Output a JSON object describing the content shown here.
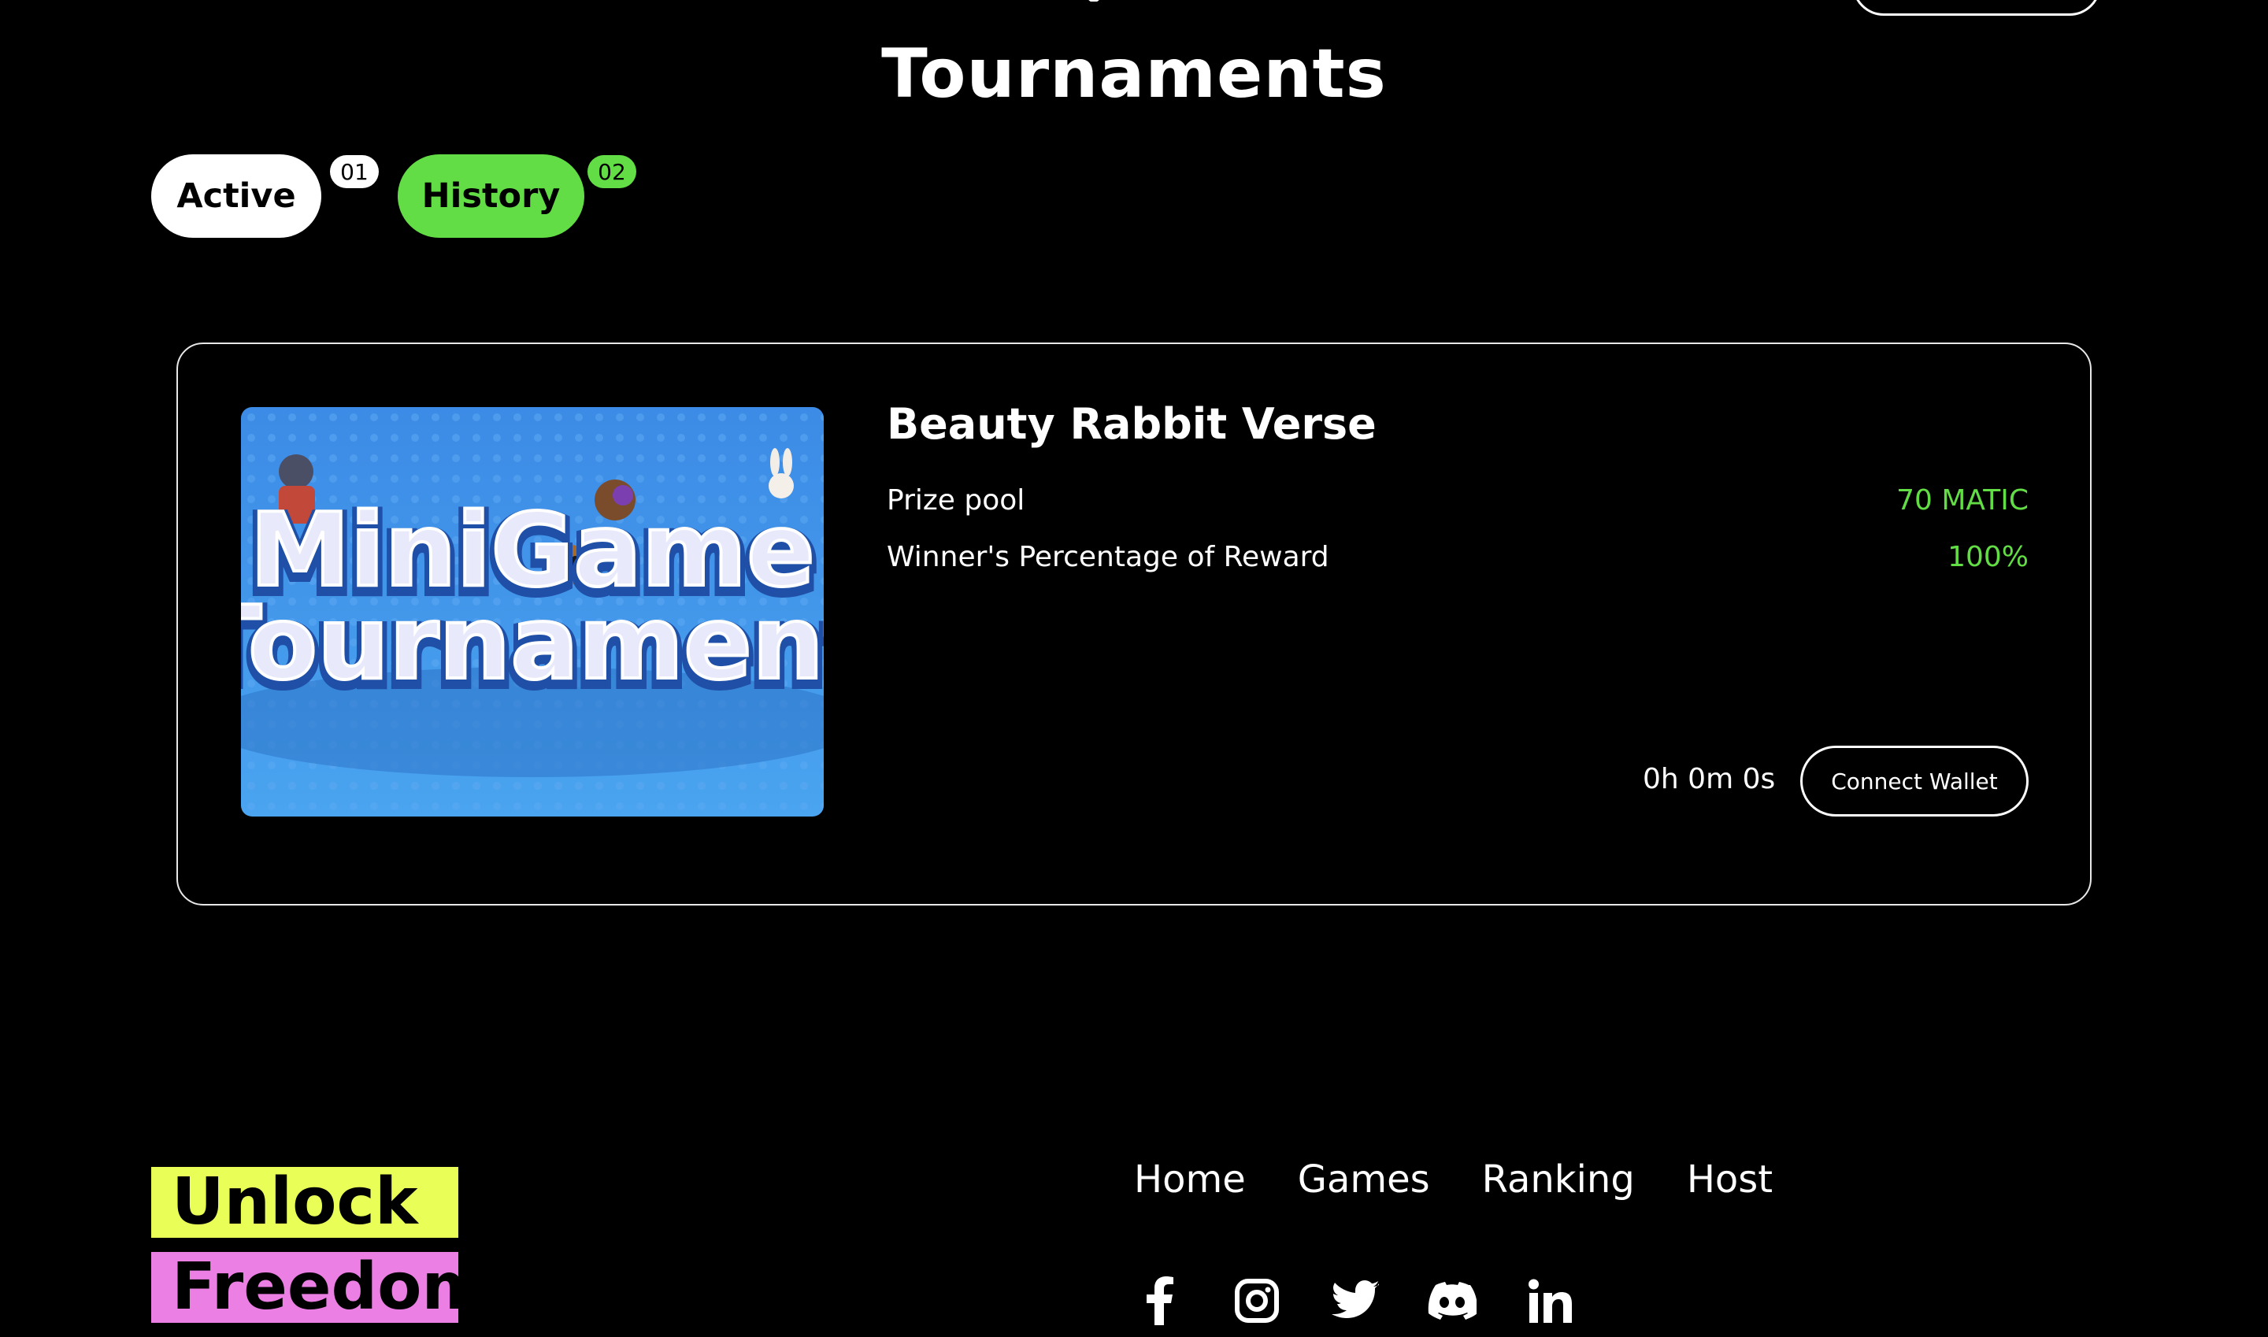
{
  "header": {
    "title": "Tournaments"
  },
  "tabs": [
    {
      "label": "Active",
      "count": "01"
    },
    {
      "label": "History",
      "count": "02"
    }
  ],
  "tournament": {
    "name": "Beauty Rabbit Verse",
    "image_text_line1": "MiniGame",
    "image_text_line2": "Tournament",
    "prize_label": "Prize pool",
    "prize_value": "70 MATIC",
    "winner_label": "Winner's Percentage of Reward",
    "winner_value": "100%",
    "timer": "0h 0m 0s",
    "connect_label": "Connect Wallet"
  },
  "footer": {
    "brand_line1": "Unlock",
    "brand_line2": "Freedom",
    "nav": [
      "Home",
      "Games",
      "Ranking",
      "Host"
    ],
    "socials": [
      "facebook-icon",
      "instagram-icon",
      "twitter-icon",
      "discord-icon",
      "linkedin-icon"
    ]
  },
  "colors": {
    "accent_green": "#62dd45",
    "brand_yellow": "#e9ff58",
    "brand_pink": "#ec7fe4",
    "background": "#000000"
  }
}
